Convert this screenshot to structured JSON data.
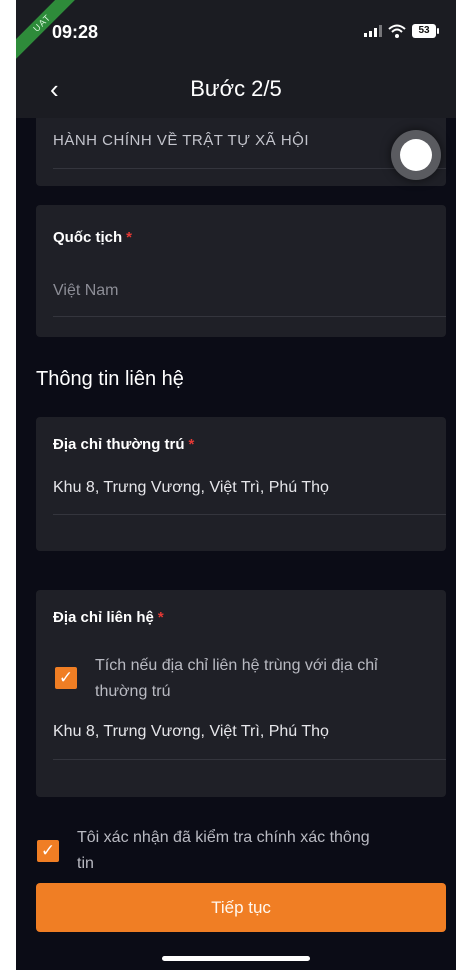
{
  "status_bar": {
    "time": "09:28",
    "battery": "53",
    "ribbon": "UAT"
  },
  "nav": {
    "back_icon": "‹",
    "title": "Bước 2/5"
  },
  "cards": {
    "previous_value": "HÀNH CHÍNH VỀ TRẬT TỰ XÃ HỘI",
    "nationality": {
      "label": "Quốc tịch",
      "required": "*",
      "placeholder": "Việt Nam"
    }
  },
  "contact": {
    "section_title": "Thông tin liên hệ",
    "permanent_address": {
      "label": "Địa chỉ thường trú",
      "required": "*",
      "value": "Khu 8, Trưng Vương, Việt Trì, Phú Thọ"
    },
    "contact_address": {
      "label": "Địa chỉ liên hệ",
      "required": "*",
      "same_as_permanent_line1": "Tích nếu địa chỉ liên hệ trùng với địa chỉ",
      "same_as_permanent_line2": "thường trú",
      "same_as_permanent_checked": true,
      "value": "Khu 8, Trưng Vương, Việt Trì, Phú Thọ"
    }
  },
  "confirm": {
    "line1": "Tôi xác nhận đã kiểm tra chính xác thông",
    "line2": "tin",
    "checked": true
  },
  "check_mark": "✓",
  "continue_button": "Tiếp tục",
  "colors": {
    "accent": "#f07e24",
    "required": "#e53935",
    "background": "#0b0c16",
    "card": "#1f2027"
  }
}
